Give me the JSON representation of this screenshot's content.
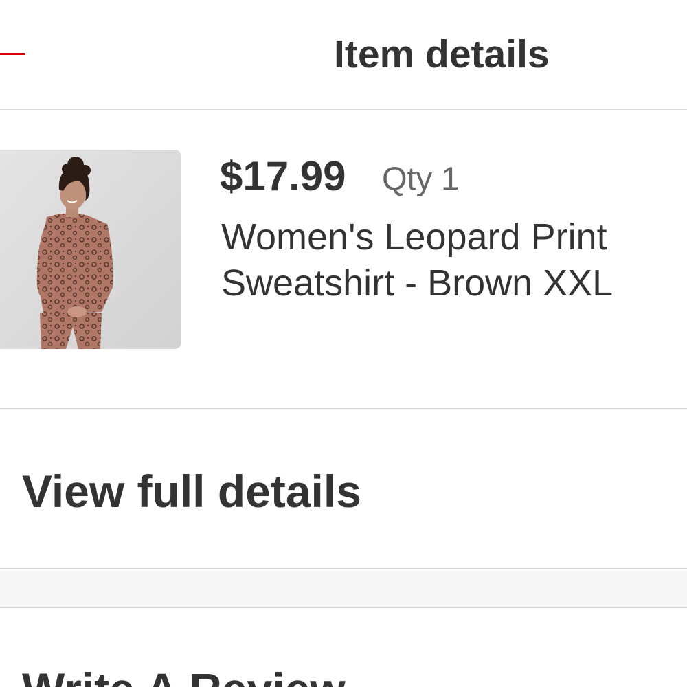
{
  "header": {
    "title": "Item details"
  },
  "product": {
    "price": "$17.99",
    "qty": "Qty 1",
    "name": "Women's Leopard Print Sweatshirt - Brown XXL",
    "image_icon": "product-photo"
  },
  "actions": {
    "view_full_details": "View full details",
    "write_review": "Write A Review"
  },
  "colors": {
    "accent": "#cc0000",
    "text": "#333333",
    "muted_text": "#666666",
    "divider": "#d6d6d6",
    "band": "#f7f7f7"
  }
}
